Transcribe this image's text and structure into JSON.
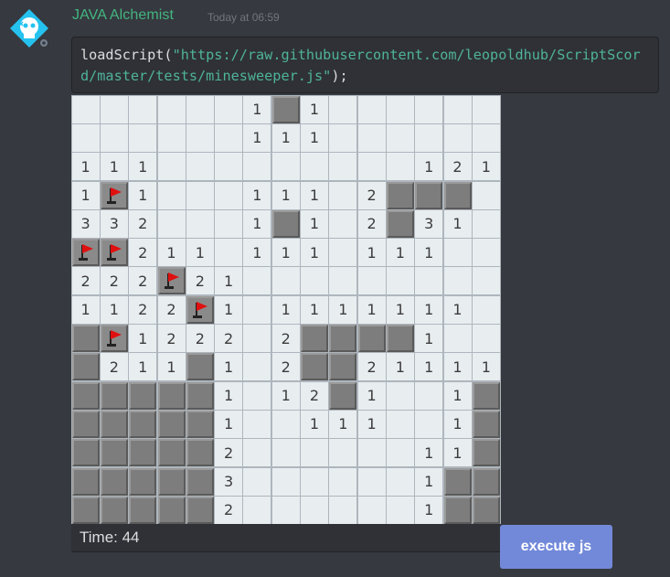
{
  "message": {
    "author": "JAVA Alchemist",
    "timestamp": "Today at 06:59",
    "code": {
      "prefix": "loadScript(",
      "url": "\"https://raw.githubusercontent.com/leopoldhub/ScriptScord/master/tests/minesweeper.js\"",
      "suffix": ");"
    }
  },
  "colors": {
    "background": "#36393f",
    "author": "#43b581",
    "button": "#7289da",
    "code_string": "#4fb39a"
  },
  "game": {
    "time_label": "Time: 44",
    "grid": [
      "......1C1......",
      "......111......",
      "111.........121",
      "1F1...111.2CCC.",
      "332...1C1.2C31.",
      "FF211.111.111..",
      "222F21.........",
      "1122F1.1111111.",
      "CF1222.2CCCC1..",
      "C211C1.2CC21111",
      "CCCCC1.12C1..1C",
      "CCCCC1..111..1C",
      "CCCCC2......11C",
      "CCCCC3......1CC",
      "CCCCC2......1CC"
    ]
  },
  "button": {
    "label": "execute js"
  }
}
